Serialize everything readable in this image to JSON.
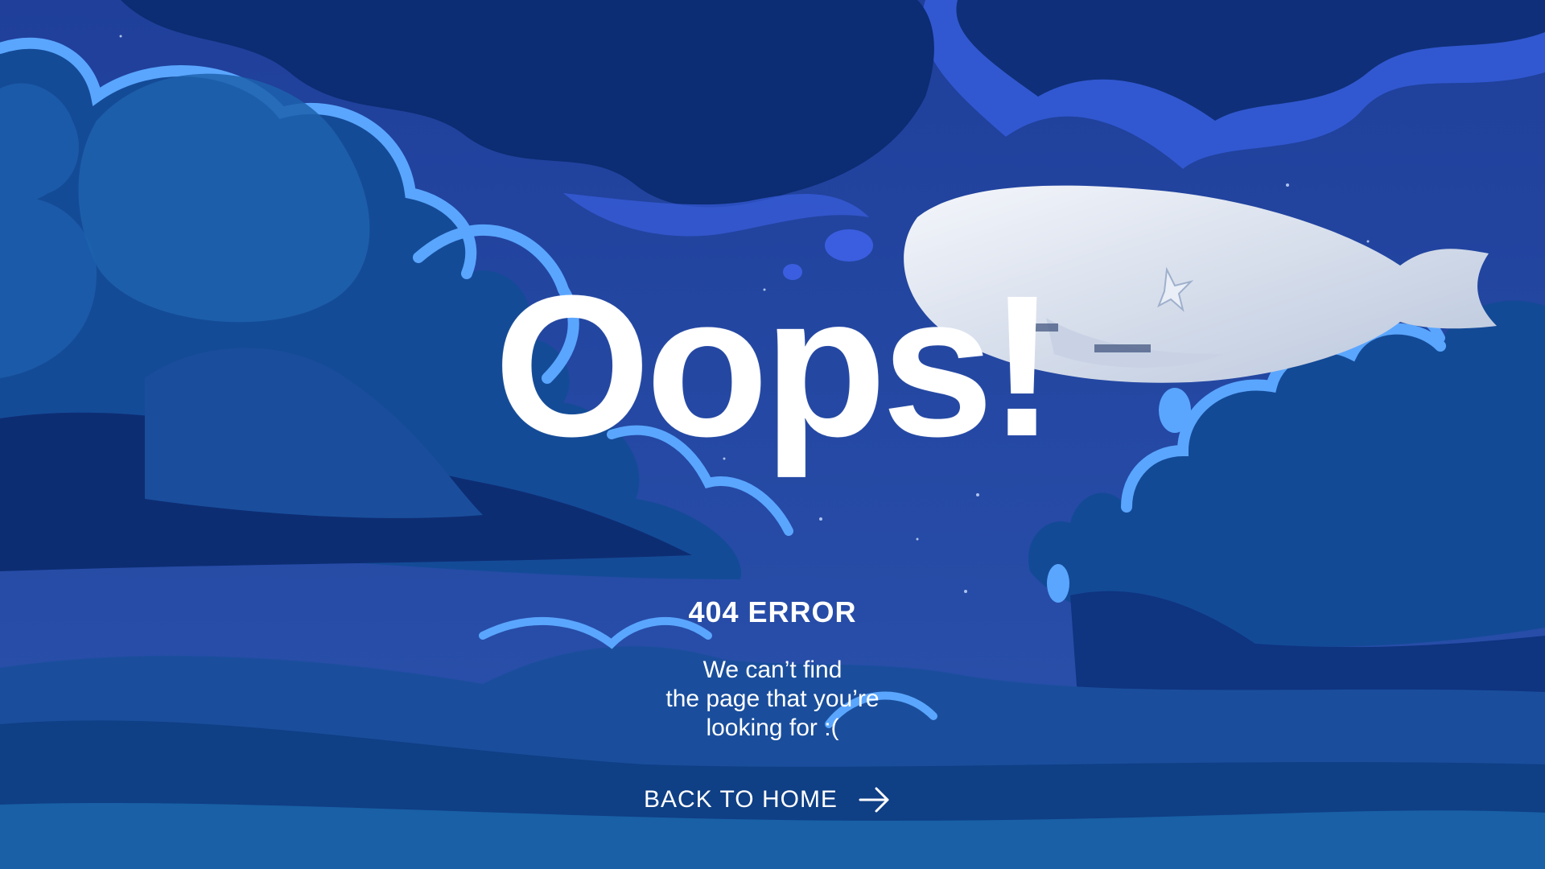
{
  "hero": {
    "headline": "Oops!"
  },
  "error": {
    "code": "404 ERROR",
    "message_lines": [
      "We can’t find",
      "the page that you’re",
      "looking for :("
    ]
  },
  "nav": {
    "back_label": "BACK TO HOME",
    "back_icon": "arrow-right-icon"
  },
  "illustration": {
    "subject": "airship-icon"
  },
  "colors": {
    "sky": "#2449a6",
    "cloud_dark": "#0d2d73",
    "cloud_mid": "#1a4e9c",
    "cloud_highlight": "#5aa6ff",
    "text": "#ffffff"
  }
}
